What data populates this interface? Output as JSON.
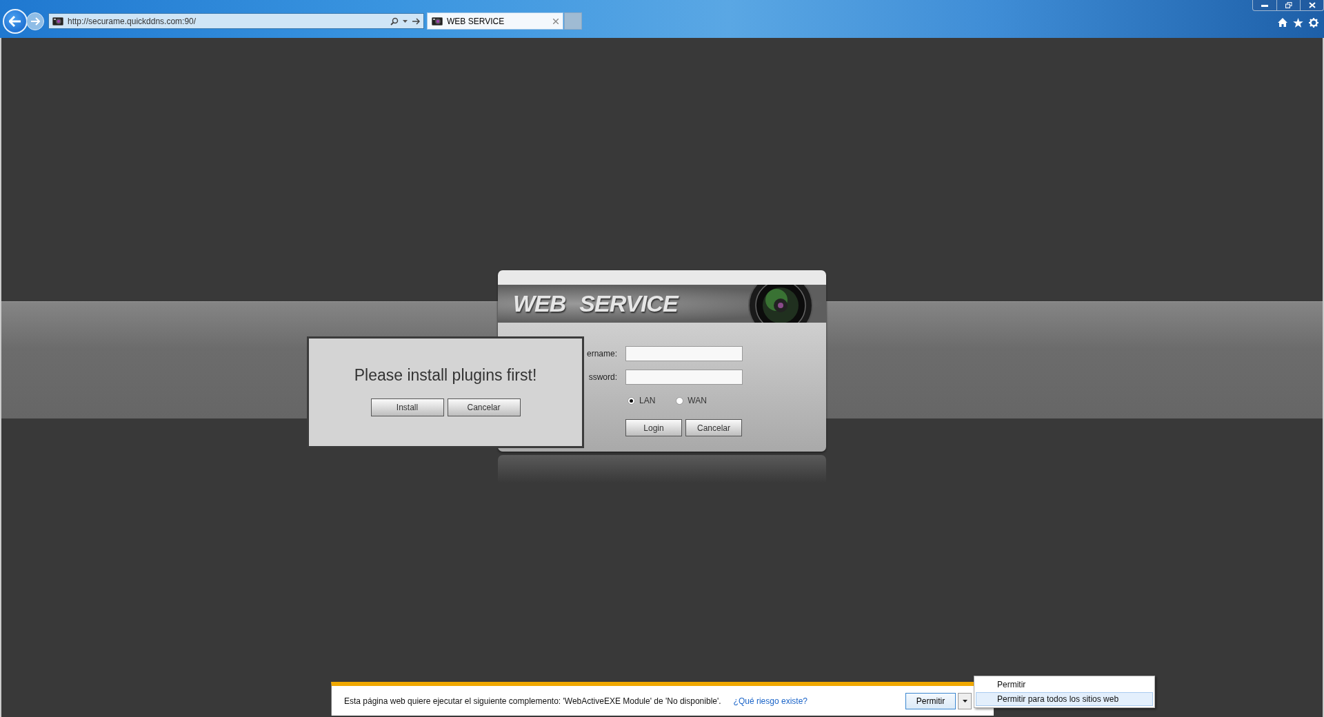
{
  "browser": {
    "address": "http://securame.quickddns.com:90/",
    "tabs": [
      {
        "title": "WEB SERVICE",
        "selected": true
      }
    ]
  },
  "login": {
    "logo": [
      "WEB",
      "SERVICE"
    ],
    "fields": [
      {
        "label": "ername:"
      },
      {
        "label": "ssword:"
      }
    ],
    "modes": [
      {
        "label": "LAN",
        "selected": true
      },
      {
        "label": "WAN",
        "selected": false
      }
    ],
    "buttons": [
      "Login",
      "Cancelar"
    ]
  },
  "plugin_dialog": {
    "message": "Please install plugins first!",
    "buttons": [
      "Install",
      "Cancelar"
    ]
  },
  "notification": {
    "message": "Esta página web quiere ejecutar el siguiente complemento: 'WebActiveEXE Module' de 'No disponible'.",
    "link": "¿Qué riesgo existe?",
    "button": "Permitir"
  },
  "menu": [
    {
      "label": "Permitir",
      "selected": false
    },
    {
      "label": "Permitir para todos los sitios web",
      "selected": true
    }
  ]
}
